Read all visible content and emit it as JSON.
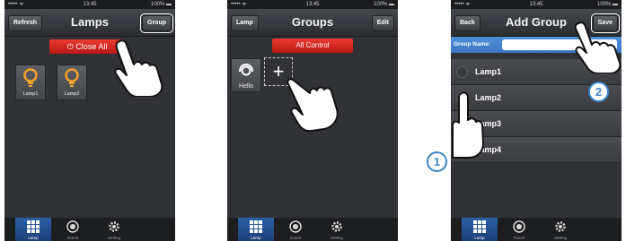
{
  "screens": [
    {
      "status": {
        "signal": "••••• ᯤ",
        "time": "13:45",
        "battery": "100% ▬"
      },
      "title": "Lamps",
      "left_button": "Refresh",
      "right_button": "Group",
      "action_button": "Close All",
      "lamps": [
        "Lamp1",
        "Lamp2"
      ],
      "tabs": [
        "Lamp",
        "Scene",
        "Setting"
      ]
    },
    {
      "status": {
        "signal": "••••• ᯤ",
        "time": "13:45",
        "battery": "100% ▬"
      },
      "title": "Groups",
      "left_button": "Lamp",
      "right_button": "Edit",
      "action_button": "All Control",
      "group": "Hello",
      "add_symbol": "+",
      "tabs": [
        "Lamp",
        "Scene",
        "Setting"
      ]
    },
    {
      "status": {
        "signal": "••••• ᯤ",
        "time": "13:45",
        "battery": "100% ▬"
      },
      "title": "Add Group",
      "left_button": "Back",
      "right_button": "Save",
      "group_name_label": "Group Name:",
      "lamps": [
        "Lamp1",
        "Lamp2",
        "Lamp3",
        "Lamp4"
      ],
      "tabs": [
        "Lamp",
        "Scene",
        "Setting"
      ]
    }
  ],
  "badges": [
    "1",
    "2"
  ],
  "colors": {
    "accent_red": "#d9261f",
    "accent_blue": "#3a86c8",
    "bulb_orange": "#f2a22a"
  }
}
